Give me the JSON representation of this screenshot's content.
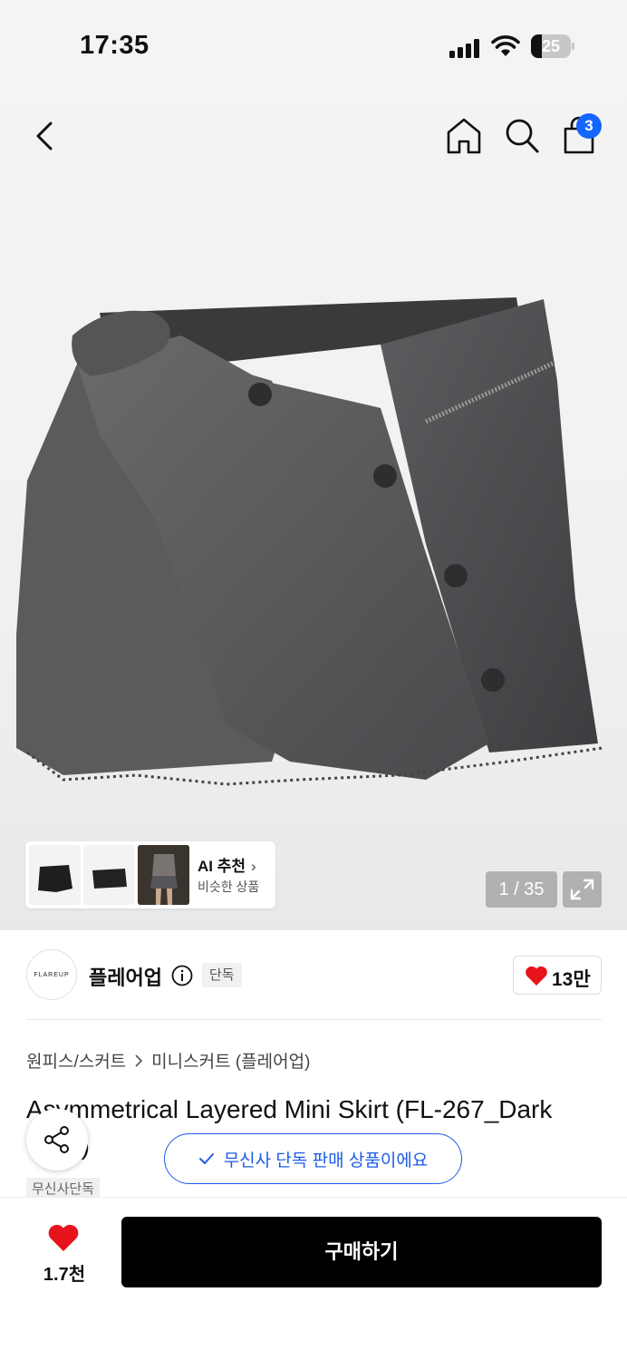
{
  "status_bar": {
    "time": "17:35",
    "battery": "25"
  },
  "nav": {
    "cart_count": "3"
  },
  "gallery": {
    "counter": "1 / 35",
    "ai": {
      "title": "AI 추천",
      "subtitle": "비슷한 상품"
    }
  },
  "brand": {
    "logo_text": "FLAREUP",
    "name": "플레어업",
    "badge": "단독",
    "likes": "13만"
  },
  "breadcrumb": {
    "category": "원피스/스커트",
    "subcategory": "미니스커트 (플레어업)"
  },
  "product": {
    "title": "Asymmetrical Layered Mini Skirt (FL-267_Dark Gray)",
    "tag": "무신사단독"
  },
  "toast": {
    "text": "무신사 단독 판매 상품이에요"
  },
  "bottom_bar": {
    "favorite_count": "1.7천",
    "buy_label": "구매하기"
  },
  "colors": {
    "accent_blue": "#1D5BE8",
    "badge_blue": "#1565FF",
    "heart_red": "#E8141B",
    "buy_button": "#000000"
  }
}
